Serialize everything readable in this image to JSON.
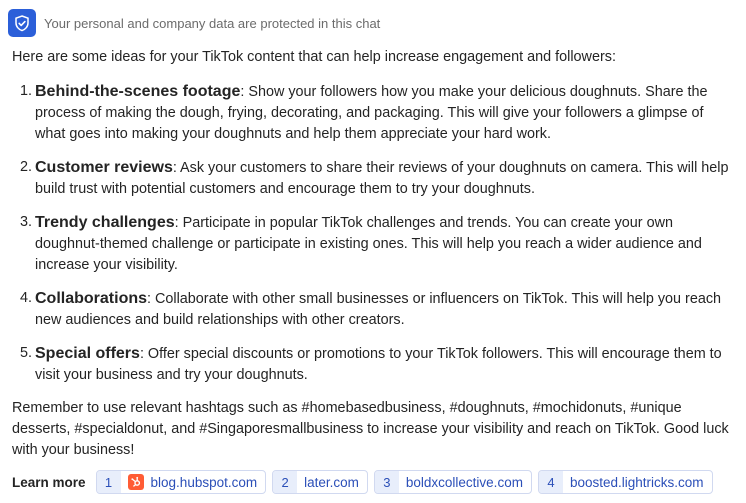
{
  "protection": {
    "text": "Your personal and company data are protected in this chat",
    "icon": "shield-check-icon",
    "accent": "#2b5fd9"
  },
  "message": {
    "intro": "Here are some ideas for your TikTok content that can help increase engagement and followers:",
    "items": [
      {
        "number": "1.",
        "title": "Behind-the-scenes footage",
        "text": ": Show your followers how you make your delicious doughnuts. Share the process of making the dough, frying, decorating, and packaging. This will give your followers a glimpse of what goes into making your doughnuts and help them appreciate your hard work."
      },
      {
        "number": "2.",
        "title": "Customer reviews",
        "text": ": Ask your customers to share their reviews of your doughnuts on camera. This will help build trust with potential customers and encourage them to try your doughnuts."
      },
      {
        "number": "3.",
        "title": "Trendy challenges",
        "text": ": Participate in popular TikTok challenges and trends. You can create your own doughnut-themed challenge or participate in existing ones. This will help you reach a wider audience and increase your visibility."
      },
      {
        "number": "4.",
        "title": "Collaborations",
        "text": ": Collaborate with other small businesses or influencers on TikTok. This will help you reach new audiences and build relationships with other creators."
      },
      {
        "number": "5.",
        "title": "Special offers",
        "text": ": Offer special discounts or promotions to your TikTok followers. This will encourage them to visit your business and try your doughnuts."
      }
    ],
    "outro": "Remember to use relevant hashtags such as #homebasedbusiness, #doughnuts, #mochidonuts, #unique desserts, #specialdonut, and #Singaporesmallbusiness to increase your visibility and reach on TikTok. Good luck with your business!"
  },
  "learn_more": {
    "label": "Learn more",
    "sources": [
      {
        "number": "1",
        "text": "blog.hubspot.com",
        "icon": "hubspot-icon"
      },
      {
        "number": "2",
        "text": "later.com"
      },
      {
        "number": "3",
        "text": "boldxcollective.com"
      },
      {
        "number": "4",
        "text": "boosted.lightricks.com"
      }
    ]
  }
}
